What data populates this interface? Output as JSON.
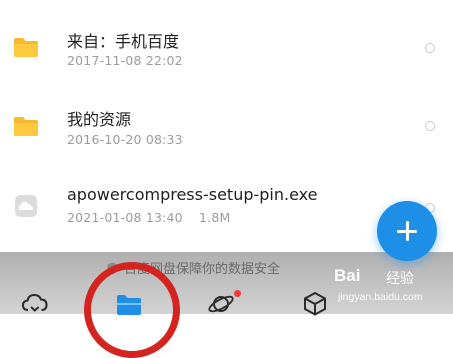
{
  "files": [
    {
      "name": "来自：手机百度",
      "date": "2017-11-08 22:02",
      "size": "",
      "type": "folder"
    },
    {
      "name": "我的资源",
      "date": "2016-10-20 08:33",
      "size": "",
      "type": "folder"
    },
    {
      "name": "apowercompress-setup-pin.exe",
      "date": "2021-01-08 13:40",
      "size": "1.8M",
      "type": "file"
    }
  ],
  "fab": {
    "icon": "plus-icon"
  },
  "notice": {
    "text": "百度网盘保障你的数据安全"
  },
  "tabs": [
    {
      "icon": "cloud-icon"
    },
    {
      "icon": "folder-icon",
      "selected": true
    },
    {
      "icon": "planet-icon",
      "badge": true
    },
    {
      "icon": "cube-icon"
    }
  ],
  "watermark": {
    "logo": "Bai",
    "name": "经验",
    "url": "jingyan.baidu.com"
  },
  "colors": {
    "accent": "#1e8fe6",
    "folder": "#f5b82e",
    "annotation": "#d4241f",
    "badge": "#f23b3b"
  }
}
